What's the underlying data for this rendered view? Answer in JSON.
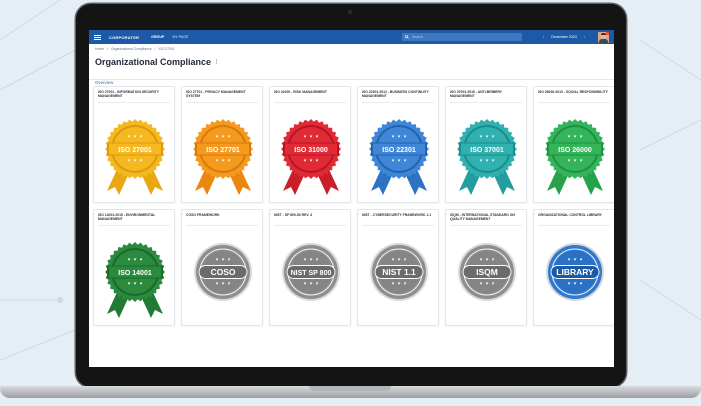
{
  "topbar": {
    "logo": "CORPORATER",
    "logo_sub": "",
    "group_label": "GROUP",
    "page_label": "MY PAGE",
    "search_placeholder": "Search",
    "prev_arrow": "‹",
    "date_label": "December 2024",
    "next_arrow": "›"
  },
  "breadcrumb": {
    "items": [
      "Home",
      "Organizational Compliance",
      "ISO 27001"
    ],
    "separator": "/"
  },
  "page": {
    "title": "Organizational Compliance",
    "menu_glyph": "⋮",
    "tab_overview": "Overview"
  },
  "cards": [
    {
      "title": "ISO 27001 - INFORMATION SECURITY MANAGEMENT",
      "badge": "ISO 27001",
      "color": "#f5b820",
      "dark": "#d99b0c",
      "ribbon": "#e8a713",
      "style": "rosette"
    },
    {
      "title": "ISO 27701 - PRIVACY MANAGEMENT SYSTEM",
      "badge": "ISO 27701",
      "color": "#f39a1f",
      "dark": "#d87a0a",
      "ribbon": "#e9870f",
      "style": "rosette"
    },
    {
      "title": "ISO 31000 - RISK MANAGEMENT",
      "badge": "ISO 31000",
      "color": "#e02a35",
      "dark": "#b81523",
      "ribbon": "#c91f2b",
      "style": "rosette"
    },
    {
      "title": "ISO 22301:2012 - BUSINESS CONTINUITY MANAGEMENT",
      "badge": "ISO 22301",
      "color": "#3f86d6",
      "dark": "#2363ad",
      "ribbon": "#2e72c2",
      "style": "rosette"
    },
    {
      "title": "ISO 37001:2016 - ANTI-BRIBERY MANAGEMENT",
      "badge": "ISO 37001",
      "color": "#30b1b0",
      "dark": "#1a8d8c",
      "ribbon": "#239e9d",
      "style": "rosette"
    },
    {
      "title": "ISO 26000:2010 - SOCIAL RESPONSIBILITY",
      "badge": "ISO 26000",
      "color": "#35b55a",
      "dark": "#1f9140",
      "ribbon": "#27a24b",
      "style": "rosette"
    },
    {
      "title": "ISO 14001:2015 - ENVIRONMENTAL MANAGEMENT",
      "badge": "ISO 14001",
      "color": "#2b8a3e",
      "dark": "#1b6a2b",
      "ribbon": "#237a35",
      "style": "rosette"
    },
    {
      "title": "COSO FRAMEWORK",
      "badge": "COSO",
      "color": "#8e8e8e",
      "dark": "#6b6b6b",
      "ribbon": "",
      "style": "seal"
    },
    {
      "title": "NIST - SP 800-53 REV. 4",
      "badge": "NIST SP 800",
      "color": "#8e8e8e",
      "dark": "#6b6b6b",
      "ribbon": "",
      "style": "seal"
    },
    {
      "title": "NIST - CYBERSECURITY FRAMEWORK 1.1",
      "badge": "NIST 1.1",
      "color": "#8e8e8e",
      "dark": "#6b6b6b",
      "ribbon": "",
      "style": "seal"
    },
    {
      "title": "ISQM - INTERNATIONAL STANDARD ON QUALITY MANAGEMENT",
      "badge": "ISQM",
      "color": "#8e8e8e",
      "dark": "#6b6b6b",
      "ribbon": "",
      "style": "seal"
    },
    {
      "title": "ORGANIZATIONAL CONTROL LIBRARY",
      "badge": "LIBRARY",
      "color": "#2f79cf",
      "dark": "#1b5aa6",
      "ribbon": "",
      "style": "seal"
    }
  ]
}
